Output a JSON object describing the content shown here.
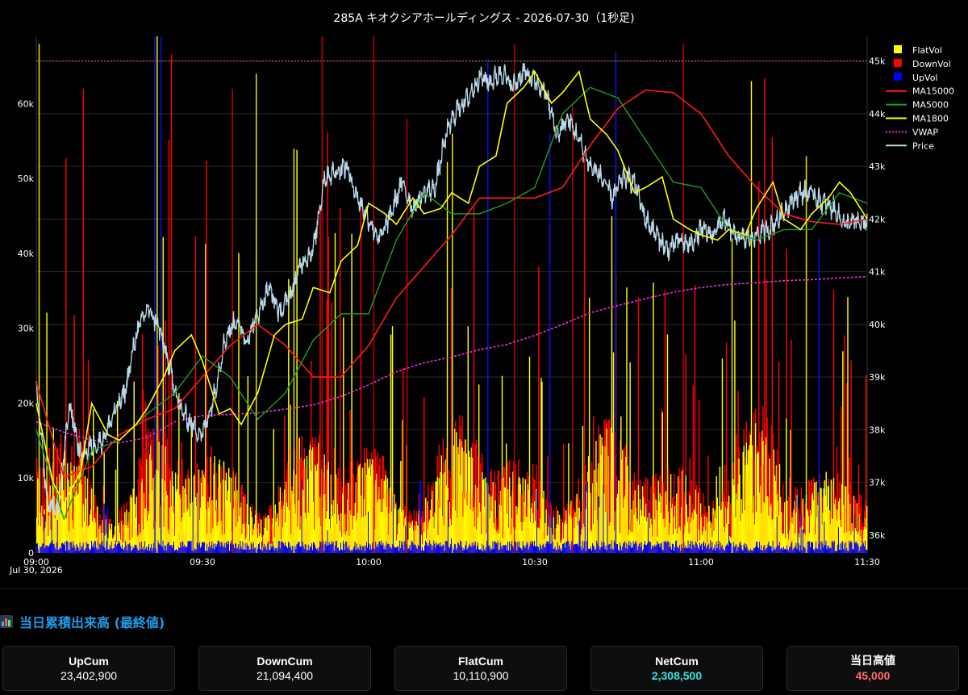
{
  "chart_data": {
    "type": "bar+line",
    "title": "285A キオクシアホールディングス - 2026-07-30（1秒足)",
    "x_axis": {
      "range": [
        "09:00",
        "11:30"
      ],
      "ticks": [
        "09:00",
        "09:30",
        "10:00",
        "10:30",
        "11:00",
        "11:30"
      ],
      "date_label": "Jul 30, 2026"
    },
    "y_left": {
      "range": [
        0,
        69000
      ],
      "ticks": [
        "0",
        "10k",
        "20k",
        "30k",
        "40k",
        "50k",
        "60k"
      ],
      "tick_values": [
        0,
        10000,
        20000,
        30000,
        40000,
        50000,
        60000
      ]
    },
    "y_right": {
      "range": [
        35660,
        45470
      ],
      "ticks": [
        "36k",
        "37k",
        "38k",
        "39k",
        "40k",
        "41k",
        "42k",
        "43k",
        "44k",
        "45k"
      ],
      "tick_values": [
        36000,
        37000,
        38000,
        39000,
        40000,
        41000,
        42000,
        43000,
        44000,
        45000
      ]
    },
    "reference_line": {
      "value": 45000,
      "color": "#d96b6b",
      "style": "dotted"
    },
    "legend_position": "top-right",
    "series": [
      {
        "name": "FlatVol",
        "kind": "bar",
        "color": "#ffff00"
      },
      {
        "name": "DownVol",
        "kind": "bar",
        "color": "#ff0000"
      },
      {
        "name": "UpVol",
        "kind": "bar",
        "color": "#0000ff"
      },
      {
        "name": "MA15000",
        "kind": "line",
        "color": "#ff1a1a",
        "t": [
          0,
          5,
          10,
          15,
          20,
          25,
          30,
          35,
          40,
          45,
          50,
          55,
          60,
          65,
          70,
          75,
          80,
          85,
          90,
          95,
          100,
          105,
          110,
          115,
          120,
          125,
          130,
          135,
          140,
          145,
          150
        ],
        "values": [
          38900,
          37100,
          37300,
          37900,
          38200,
          38400,
          39000,
          39600,
          40000,
          39600,
          39000,
          39000,
          39600,
          40500,
          41100,
          41700,
          42400,
          42400,
          42400,
          42600,
          43400,
          44100,
          44450,
          44400,
          44000,
          43200,
          42600,
          42100,
          41950,
          41900,
          42000
        ]
      },
      {
        "name": "MA5000",
        "kind": "line",
        "color": "#1f9e1f",
        "t": [
          0,
          5,
          10,
          15,
          20,
          25,
          30,
          35,
          40,
          45,
          50,
          55,
          60,
          65,
          70,
          75,
          80,
          85,
          90,
          95,
          100,
          105,
          110,
          115,
          120,
          125,
          130,
          135,
          140,
          145,
          150
        ],
        "values": [
          38000,
          36300,
          37600,
          37800,
          38300,
          38700,
          39400,
          39000,
          38200,
          38700,
          39700,
          40200,
          40200,
          41600,
          42500,
          42100,
          42100,
          42300,
          42600,
          44000,
          44500,
          44300,
          43500,
          42700,
          42600,
          41800,
          41600,
          41800,
          41800,
          42500,
          42300
        ]
      },
      {
        "name": "MA1800",
        "kind": "line",
        "color": "#ffff00",
        "t": [
          0,
          3,
          5,
          8,
          10,
          13,
          15,
          18,
          20,
          23,
          25,
          28,
          30,
          33,
          35,
          37,
          40,
          43,
          45,
          48,
          50,
          53,
          55,
          58,
          60,
          63,
          65,
          68,
          70,
          73,
          75,
          78,
          80,
          83,
          85,
          88,
          90,
          93,
          95,
          98,
          100,
          103,
          105,
          108,
          110,
          113,
          115,
          118,
          120,
          123,
          125,
          128,
          130,
          133,
          135,
          138,
          140,
          143,
          145,
          147,
          150
        ],
        "values": [
          38500,
          37000,
          36600,
          37200,
          38500,
          37900,
          37800,
          38100,
          38400,
          39000,
          39500,
          39800,
          39300,
          38300,
          38400,
          38100,
          38700,
          39800,
          40000,
          40100,
          40700,
          40600,
          41200,
          41500,
          42300,
          42100,
          41900,
          42400,
          42100,
          42200,
          42500,
          42300,
          43000,
          43200,
          44200,
          44500,
          44800,
          44200,
          44400,
          44800,
          43900,
          43600,
          43300,
          42500,
          42600,
          42800,
          42000,
          41800,
          41700,
          41600,
          41800,
          41700,
          42200,
          42700,
          42000,
          41800,
          42100,
          42400,
          42700,
          42500,
          42000
        ]
      },
      {
        "name": "VWAP",
        "kind": "line",
        "color": "#e52ee5",
        "style": "dotted",
        "t": [
          0,
          5,
          10,
          15,
          20,
          25,
          30,
          35,
          40,
          45,
          50,
          55,
          60,
          65,
          70,
          75,
          80,
          85,
          90,
          95,
          100,
          105,
          110,
          115,
          120,
          125,
          130,
          135,
          140,
          145,
          150
        ],
        "values": [
          38150,
          37950,
          37800,
          37750,
          37850,
          38150,
          38270,
          38290,
          38320,
          38390,
          38470,
          38630,
          38850,
          39100,
          39270,
          39380,
          39520,
          39620,
          39790,
          40000,
          40220,
          40360,
          40490,
          40610,
          40700,
          40760,
          40790,
          40830,
          40850,
          40880,
          40910
        ]
      },
      {
        "name": "Price",
        "kind": "line",
        "color": "#b9d9e8",
        "t": [
          0,
          2,
          4,
          6,
          8,
          10,
          12,
          14,
          16,
          18,
          20,
          22,
          24,
          26,
          28,
          30,
          32,
          34,
          36,
          38,
          40,
          42,
          44,
          46,
          48,
          50,
          52,
          54,
          56,
          58,
          60,
          62,
          64,
          66,
          68,
          70,
          72,
          74,
          76,
          78,
          80,
          82,
          84,
          86,
          88,
          90,
          92,
          94,
          96,
          98,
          100,
          102,
          104,
          106,
          108,
          110,
          112,
          114,
          116,
          118,
          120,
          122,
          124,
          126,
          128,
          130,
          132,
          134,
          136,
          138,
          140,
          142,
          144,
          146,
          148,
          150
        ],
        "values": [
          38800,
          36600,
          36500,
          38500,
          37500,
          37700,
          37800,
          38300,
          38700,
          39800,
          40300,
          40000,
          39200,
          38400,
          38100,
          37900,
          38600,
          39700,
          40100,
          39700,
          40200,
          40700,
          40200,
          40600,
          41200,
          41400,
          42800,
          42900,
          43000,
          42400,
          42000,
          41600,
          42100,
          42700,
          42200,
          42500,
          42600,
          43600,
          44100,
          44300,
          44700,
          44600,
          44800,
          44500,
          44800,
          44600,
          44400,
          43600,
          43900,
          43500,
          43000,
          42800,
          42400,
          42800,
          42700,
          42000,
          41700,
          41400,
          41600,
          41500,
          41800,
          41700,
          42000,
          41700,
          41600,
          41700,
          41800,
          42000,
          42300,
          42500,
          42500,
          42300,
          42200,
          41900,
          41950,
          41900
        ]
      }
    ],
    "volume_model": {
      "bars": 1000,
      "flat_typical": 6500,
      "down_typical": 8500,
      "up_typical": 1200,
      "tall_spikes": [
        {
          "t": 0.4,
          "series": "FlatVol",
          "value": 68000
        },
        {
          "t": 21.3,
          "series": "UpVol",
          "value": 69000
        },
        {
          "t": 22.4,
          "series": "UpVol",
          "value": 69000
        },
        {
          "t": 21.7,
          "series": "FlatVol",
          "value": 69000
        },
        {
          "t": 51.5,
          "series": "DownVol",
          "value": 69000
        },
        {
          "t": 60.8,
          "series": "DownVol",
          "value": 69000
        },
        {
          "t": 86.2,
          "series": "DownVol",
          "value": 68000
        },
        {
          "t": 116.7,
          "series": "DownVol",
          "value": 68000
        },
        {
          "t": 35.3,
          "series": "DownVol",
          "value": 62000
        },
        {
          "t": 39.6,
          "series": "FlatVol",
          "value": 64000
        },
        {
          "t": 46.4,
          "series": "FlatVol",
          "value": 54000
        },
        {
          "t": 66.8,
          "series": "DownVol",
          "value": 58000
        },
        {
          "t": 75.0,
          "series": "FlatVol",
          "value": 56000
        },
        {
          "t": 81.4,
          "series": "UpVol",
          "value": 66000
        },
        {
          "t": 92.6,
          "series": "UpVol",
          "value": 56000
        },
        {
          "t": 96.7,
          "series": "DownVol",
          "value": 60000
        },
        {
          "t": 104.5,
          "series": "UpVol",
          "value": 67000
        },
        {
          "t": 125.5,
          "series": "FlatVol",
          "value": 42000
        },
        {
          "t": 141.2,
          "series": "UpVol",
          "value": 42000
        },
        {
          "t": 138.9,
          "series": "FlatVol",
          "value": 53000
        }
      ]
    }
  },
  "section": {
    "title": "当日累積出来高 (最終値)",
    "icon": "bar-chart-icon"
  },
  "cards": [
    {
      "label": "UpCum",
      "value": "23,402,900"
    },
    {
      "label": "DownCum",
      "value": "21,094,400"
    },
    {
      "label": "FlatCum",
      "value": "10,110,900"
    },
    {
      "label": "NetCum",
      "value": "2,308,500",
      "accent": "#2ee6e6"
    },
    {
      "label": "当日高値",
      "value": "45,000",
      "accent": "#ff6b6b"
    }
  ]
}
